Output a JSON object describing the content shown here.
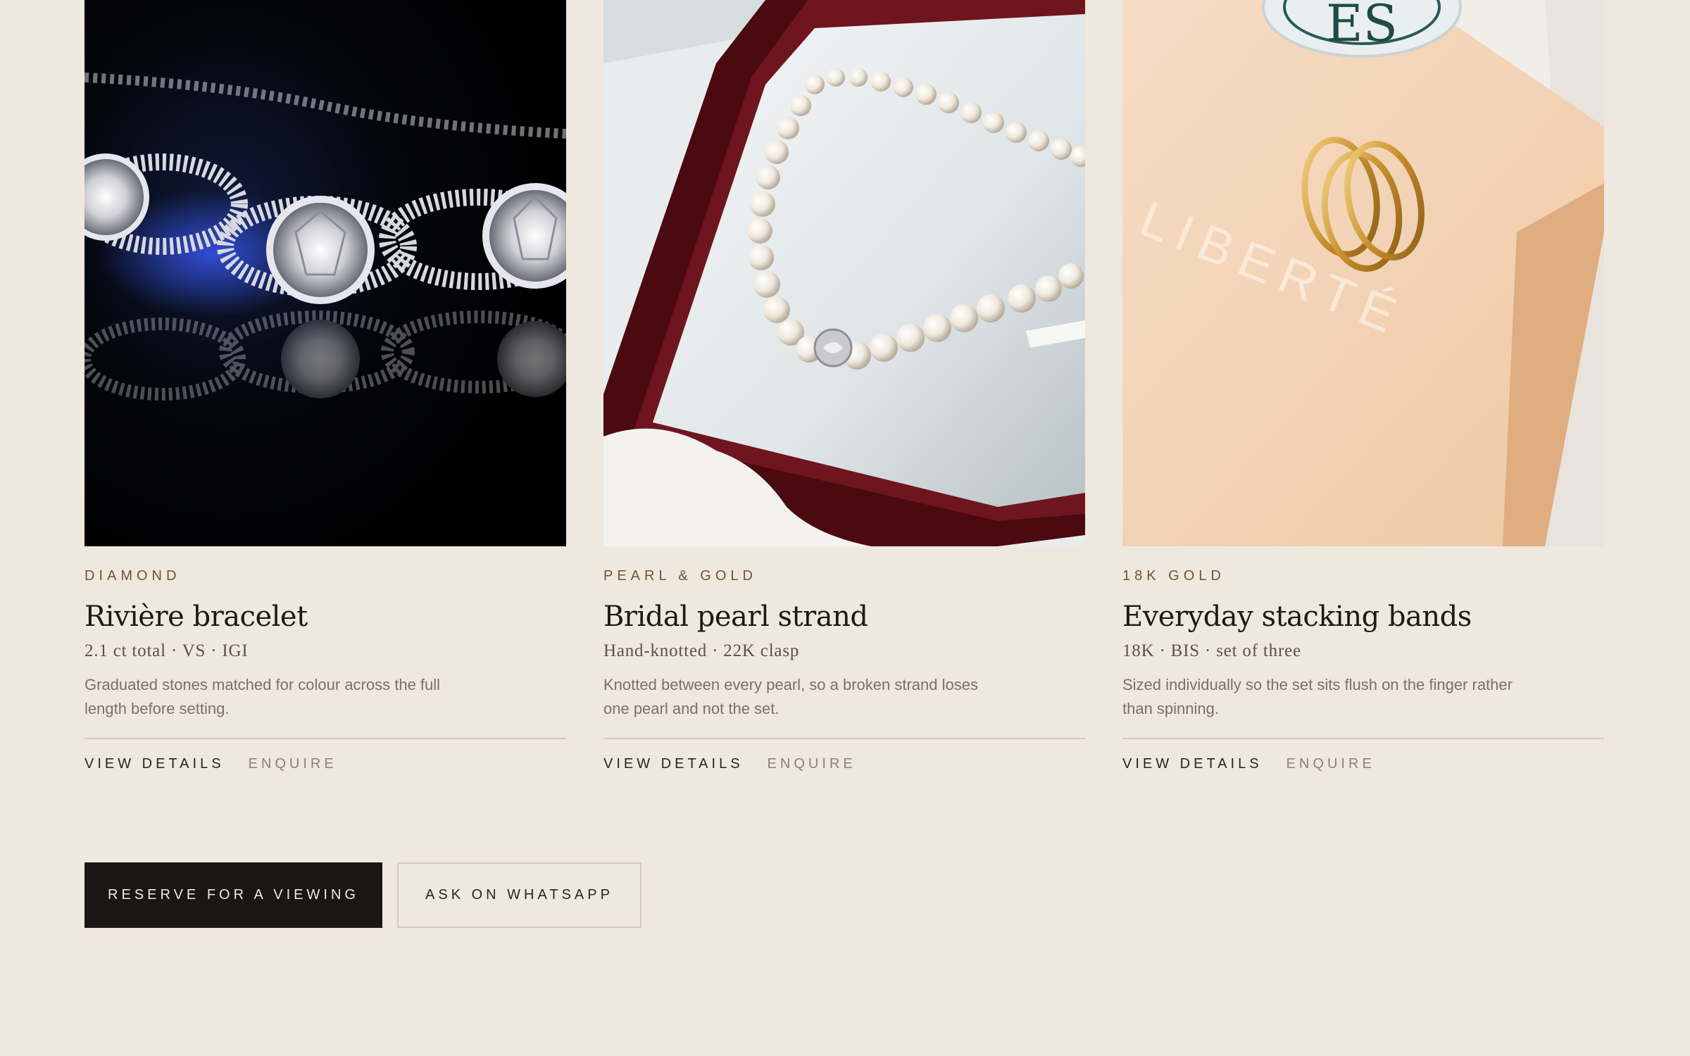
{
  "products": [
    {
      "category": "DIAMOND",
      "name": "Rivière bracelet",
      "spec": "2.1 ct total · VS · IGI",
      "description": "Graduated stones matched for colour across the full length before setting.",
      "view_label": "VIEW DETAILS",
      "enquire_label": "ENQUIRE"
    },
    {
      "category": "PEARL & GOLD",
      "name": "Bridal pearl strand",
      "spec": "Hand-knotted · 22K clasp",
      "description": "Knotted between every pearl, so a broken strand loses one pearl and not the set.",
      "view_label": "VIEW DETAILS",
      "enquire_label": "ENQUIRE"
    },
    {
      "category": "18K GOLD",
      "name": "Everyday stacking bands",
      "spec": "18K · BIS · set of three",
      "description": "Sized individually so the set sits flush on the finger rather than spinning.",
      "view_label": "VIEW DETAILS",
      "enquire_label": "ENQUIRE"
    }
  ],
  "cta": {
    "reserve_label": "RESERVE FOR A VIEWING",
    "whatsapp_label": "ASK ON WHATSAPP"
  },
  "images": {
    "box_branding": "LIBERTÉ",
    "jar_lettering": "ES"
  },
  "colors": {
    "background": "#efe8de",
    "accent": "#6e5632",
    "dark_button": "#1a1614"
  }
}
